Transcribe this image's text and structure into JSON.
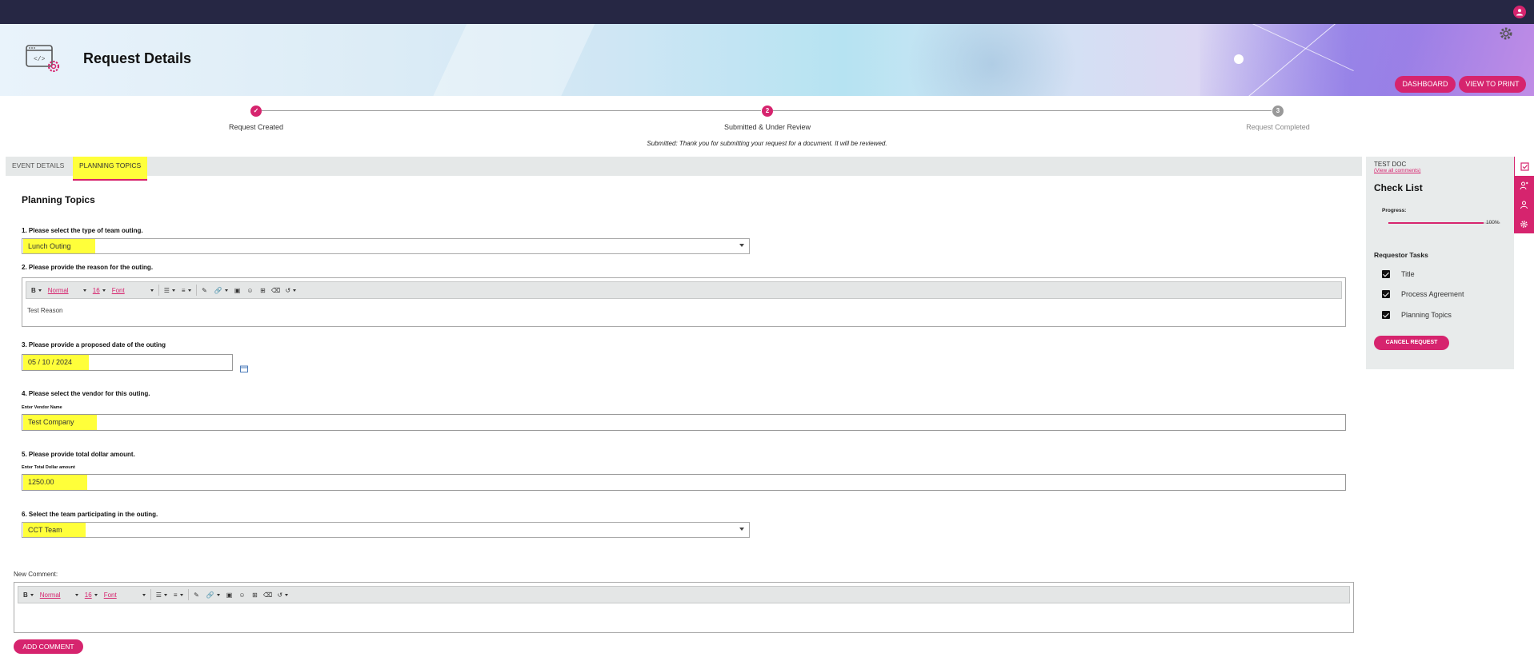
{
  "header": {
    "page_title": "Request Details",
    "dashboard_label": "DASHBOARD",
    "print_label": "VIEW TO PRINT",
    "icons": [
      "user-icon",
      "code-settings-icon",
      "gear-icon"
    ],
    "accent_color": "#d6246e",
    "topbar_color": "#262744"
  },
  "stepper": {
    "steps": [
      {
        "label": "Request Created",
        "marker": "✓",
        "status": "done"
      },
      {
        "label": "Submitted & Under Review",
        "marker": "2",
        "status": "current"
      },
      {
        "label": "Request Completed",
        "marker": "3",
        "status": "pending"
      }
    ],
    "message": "Submitted: Thank you for submitting your request for a document. It will be reviewed."
  },
  "tabs": {
    "event_details": "EVENT DETAILS",
    "planning_topics": "PLANNING TOPICS",
    "active": "PLANNING TOPICS"
  },
  "form": {
    "section_title": "Planning Topics",
    "q1": {
      "label": "1. Please select the type of team outing.",
      "value": "Lunch Outing"
    },
    "q2": {
      "label": "2. Please provide the reason for the outing.",
      "value": "Test Reason"
    },
    "q3": {
      "label": "3. Please provide a proposed date of the outing",
      "value": "05 / 10 / 2024"
    },
    "q4": {
      "label": "4. Please select the vendor for this outing.",
      "sub_label": "Enter Vendor Name",
      "value": "Test Company"
    },
    "q5": {
      "label": "5. Please provide total dollar amount.",
      "sub_label": "Enter Total Dollar amount",
      "value": "1250.00"
    },
    "q6": {
      "label": "6. Select the team participating in the outing.",
      "value": "CCT Team"
    }
  },
  "editor_toolbar": {
    "bold": "B",
    "format": "Normal",
    "size": "16",
    "font": "Font"
  },
  "comment": {
    "label": "New Comment:",
    "button": "ADD COMMENT"
  },
  "checklist": {
    "doc_name": "TEST DOC",
    "view_comments": "(View all comments)",
    "title": "Check List",
    "progress_label": "Progress:",
    "progress_value": "100%",
    "progress_fraction": 1.0,
    "tasks_title": "Requestor Tasks",
    "tasks": [
      {
        "label": "Title",
        "checked": true
      },
      {
        "label": "Process Agreement",
        "checked": true
      },
      {
        "label": "Planning Topics",
        "checked": true
      }
    ],
    "cancel_label": "CANCEL REQUEST"
  }
}
